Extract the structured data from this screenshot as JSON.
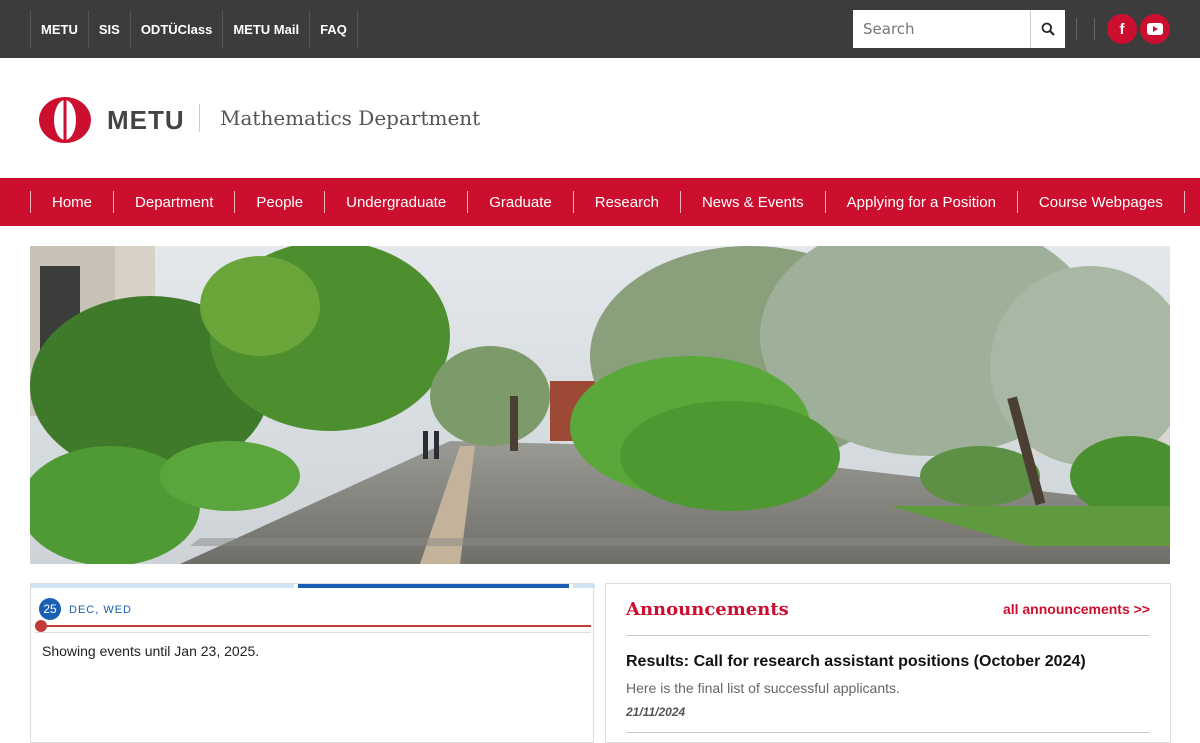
{
  "topbar": {
    "links": [
      "METU",
      "SIS",
      "ODTÜClass",
      "METU Mail",
      "FAQ"
    ],
    "search_placeholder": "Search"
  },
  "header": {
    "logo_text": "METU",
    "department": "Mathematics Department"
  },
  "nav": {
    "items": [
      "Home",
      "Department",
      "People",
      "Undergraduate",
      "Graduate",
      "Research",
      "News & Events",
      "Applying for a Position",
      "Course Webpages"
    ]
  },
  "events": {
    "day": "25",
    "month_weekday": "DEC, WED",
    "note": "Showing events until Jan 23, 2025."
  },
  "announcements": {
    "title": "Announcements",
    "all_link": "all announcements >>",
    "items": [
      {
        "title": "Results: Call for research assistant positions (October 2024)",
        "description": "Here is the final list of successful applicants.",
        "date": "21/11/2024"
      }
    ]
  },
  "colors": {
    "brand_red": "#cc0e2f",
    "topbar_bg": "#3c3c3c",
    "calendar_blue": "#1a5fb4"
  }
}
